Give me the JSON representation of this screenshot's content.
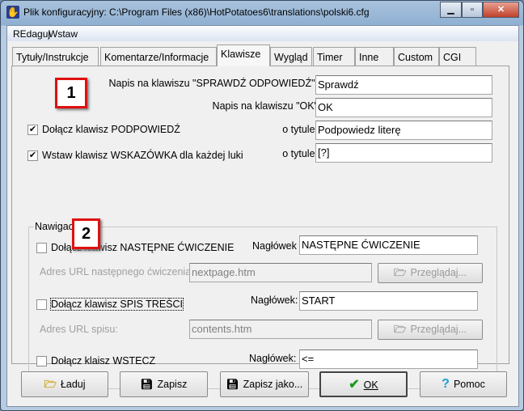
{
  "window": {
    "title": "Plik konfiguracyjny: C:\\Program Files (x86)\\HotPotatoes6\\translations\\polski6.cfg"
  },
  "menu": [
    "REdaguj",
    "Wstaw"
  ],
  "tabs": [
    "Tytuły/Instrukcje",
    "Komentarze/Informacje",
    "Klawisze",
    "Wygląd",
    "Timer",
    "Inne",
    "Custom",
    "CGI"
  ],
  "selected_tab": "Klawisze",
  "keys": {
    "check_label": "Napis na klawiszu \"SPRAWDŹ ODPOWIEDŹ\":",
    "check_value": "Sprawdź",
    "ok_label": "Napis na klawiszu \"OK\"",
    "ok_value": "OK",
    "hint_checkbox": "Dołącz klawisz PODPOWIEDŹ",
    "hint_checked": true,
    "hint_title_label": "o tytule:",
    "hint_value": "Podpowiedz literę",
    "clue_checkbox": "Wstaw klawisz WSKAZÓWKA dla każdej luki",
    "clue_checked": true,
    "clue_title_label": "o tytule:",
    "clue_value": "[?]"
  },
  "navigation": {
    "legend": "Nawigacja",
    "next_checkbox": "Dołącz klawisz NASTĘPNE ĆWICZENIE",
    "next_checked": false,
    "next_header_label": "Nagłówek",
    "next_value": "NASTĘPNE ĆWICZENIE",
    "next_url_label": "Adres URL następnego ćwiczenia",
    "next_url_value": "nextpage.htm",
    "browse_label": "Przeglądaj...",
    "contents_checkbox": "Dołącz klawisz SPIS TREŚCI",
    "contents_checked": false,
    "contents_header_label": "Nagłówek:",
    "contents_value": "START",
    "contents_url_label": "Adres URL spisu:",
    "contents_url_value": "contents.htm",
    "back_checkbox": "Dołącz klaisz WSTECZ",
    "back_checked": false,
    "back_header_label": "Nagłówek:",
    "back_value": "<="
  },
  "markers": [
    "1",
    "2"
  ],
  "buttons": {
    "load": "Ładuj",
    "save": "Zapisz",
    "save_as": "Zapisz jako...",
    "ok": "OK",
    "help": "Pomoc"
  }
}
